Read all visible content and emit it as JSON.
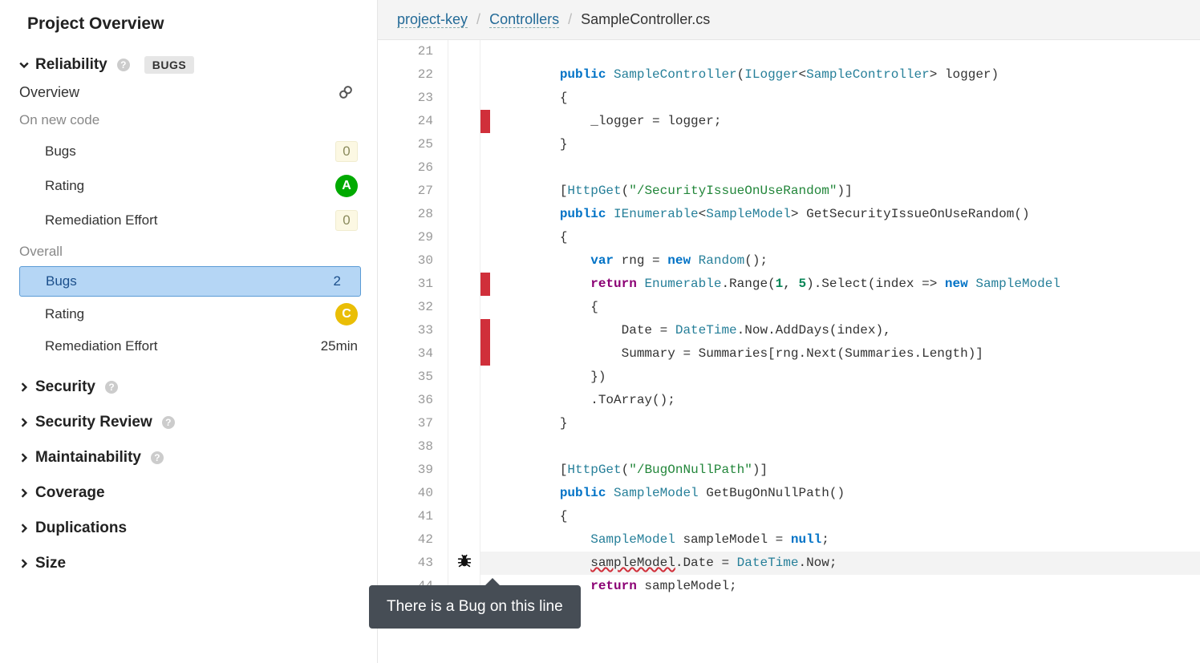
{
  "sidebar": {
    "title": "Project Overview",
    "reliability": {
      "title": "Reliability",
      "badge": "BUGS",
      "overview": "Overview",
      "newcode_label": "On new code",
      "newcode": [
        {
          "label": "Bugs",
          "value": "0",
          "kind": "square"
        },
        {
          "label": "Rating",
          "value": "A",
          "kind": "rating-A"
        },
        {
          "label": "Remediation Effort",
          "value": "0",
          "kind": "square"
        }
      ],
      "overall_label": "Overall",
      "overall": [
        {
          "label": "Bugs",
          "value": "2",
          "kind": "plain",
          "selected": true
        },
        {
          "label": "Rating",
          "value": "C",
          "kind": "rating-C"
        },
        {
          "label": "Remediation Effort",
          "value": "25min",
          "kind": "plain"
        }
      ]
    },
    "sections": [
      "Security",
      "Security Review",
      "Maintainability",
      "Coverage",
      "Duplications",
      "Size"
    ]
  },
  "breadcrumb": {
    "project": "project-key",
    "folder": "Controllers",
    "file": "SampleController.cs"
  },
  "tooltip": "There is a Bug on this line",
  "code_lines": [
    {
      "n": 21,
      "html": ""
    },
    {
      "n": 22,
      "html": "        <span class='k'>public</span> <span class='t'>SampleController</span>(<span class='t'>ILogger</span>&lt;<span class='t'>SampleController</span>&gt; logger)"
    },
    {
      "n": 23,
      "html": "        {"
    },
    {
      "n": 24,
      "red": true,
      "html": "            _logger = logger;"
    },
    {
      "n": 25,
      "html": "        }"
    },
    {
      "n": 26,
      "html": ""
    },
    {
      "n": 27,
      "html": "        [<span class='t'>HttpGet</span>(<span class='s2'>\"/SecurityIssueOnUseRandom\"</span>)]"
    },
    {
      "n": 28,
      "html": "        <span class='k'>public</span> <span class='t'>IEnumerable</span>&lt;<span class='t'>SampleModel</span>&gt; GetSecurityIssueOnUseRandom()"
    },
    {
      "n": 29,
      "html": "        {"
    },
    {
      "n": 30,
      "html": "            <span class='k'>var</span> rng = <span class='k'>new</span> <span class='t'>Random</span>();"
    },
    {
      "n": 31,
      "red": true,
      "html": "            <span class='kw2'>return</span> <span class='t'>Enumerable</span>.Range(<span class='n'>1</span>, <span class='n'>5</span>).Select(index =&gt; <span class='k'>new</span> <span class='t'>SampleModel</span>"
    },
    {
      "n": 32,
      "html": "            {"
    },
    {
      "n": 33,
      "red": true,
      "html": "                Date = <span class='t'>DateTime</span>.Now.AddDays(index),"
    },
    {
      "n": 34,
      "red": true,
      "html": "                Summary = Summaries[rng.Next(Summaries.Length)]"
    },
    {
      "n": 35,
      "html": "            })"
    },
    {
      "n": 36,
      "html": "            .ToArray();"
    },
    {
      "n": 37,
      "html": "        }"
    },
    {
      "n": 38,
      "html": ""
    },
    {
      "n": 39,
      "html": "        [<span class='t'>HttpGet</span>(<span class='s2'>\"/BugOnNullPath\"</span>)]"
    },
    {
      "n": 40,
      "html": "        <span class='k'>public</span> <span class='t'>SampleModel</span> GetBugOnNullPath()"
    },
    {
      "n": 41,
      "html": "        {"
    },
    {
      "n": 42,
      "html": "            <span class='t'>SampleModel</span> sampleModel = <span class='k'>null</span>;"
    },
    {
      "n": 43,
      "issue": true,
      "bug": true,
      "html": "            <span class='underline-err'>sampleModel</span>.Date = <span class='t'>DateTime</span>.Now;"
    },
    {
      "n": 44,
      "html": "            <span class='kw2'>return</span> sampleModel;"
    }
  ]
}
